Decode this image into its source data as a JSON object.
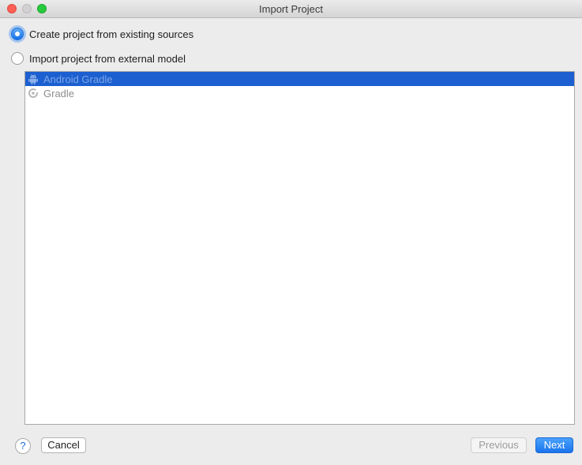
{
  "window": {
    "title": "Import Project"
  },
  "options": [
    {
      "label": "Create project from existing sources",
      "checked": true
    },
    {
      "label": "Import project from external model",
      "checked": false
    }
  ],
  "models": [
    {
      "label": "Android Gradle",
      "icon": "android-icon",
      "selected": true
    },
    {
      "label": "Gradle",
      "icon": "gradle-icon",
      "selected": false
    }
  ],
  "footer": {
    "help_label": "?",
    "cancel_label": "Cancel",
    "previous_label": "Previous",
    "next_label": "Next"
  },
  "colors": {
    "accent": "#1c5fd0",
    "primary_button": "#1a74ee"
  }
}
